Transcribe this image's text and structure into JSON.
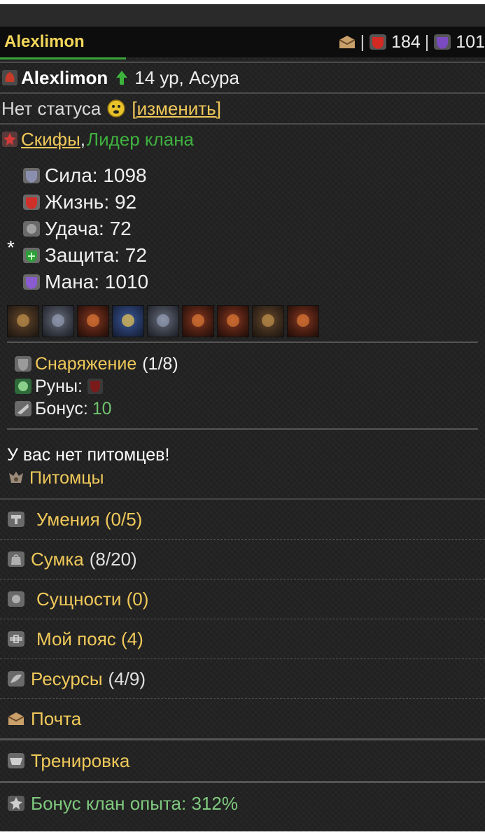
{
  "top": {
    "name": "Alexlimon",
    "health": "184",
    "mana": "101"
  },
  "profile": {
    "name": "Alexlimon",
    "level_race": "14 ур, Асура"
  },
  "status": {
    "text": "Нет статуса",
    "change": "[изменить]"
  },
  "clan": {
    "name": "Скифы",
    "comma": ",",
    "role": "Лидер клана"
  },
  "stats": [
    {
      "label": "Сила: 1098",
      "icon": "strength-icon",
      "color": "#8a8fb0"
    },
    {
      "label": "Жизнь: 92",
      "icon": "life-icon",
      "color": "#d0302a"
    },
    {
      "label": "Удача: 72",
      "icon": "luck-icon",
      "color": "#a0a0a0"
    },
    {
      "label": "Защита: 72",
      "icon": "defense-icon",
      "color": "#2e9e3a"
    },
    {
      "label": "Мана: 1010",
      "icon": "mana-icon",
      "color": "#8a5ad0"
    }
  ],
  "star": "*",
  "equip": {
    "gear_label": "Снаряжение",
    "gear_count": "(1/8)",
    "runes_label": "Руны:",
    "bonus_label": "Бонус:",
    "bonus_value": "10"
  },
  "pets": {
    "message": "У вас нет питомцев!",
    "link": "Питомцы"
  },
  "menu": {
    "skills": "Умения (0/5)",
    "bag_label": "Сумка",
    "bag_count": "(8/20)",
    "entities": "Сущности (0)",
    "belt": "Мой пояс (4)",
    "resources_label": "Ресурсы",
    "resources_count": "(4/9)",
    "mail": "Почта",
    "training": "Тренировка",
    "clan_bonus": "Бонус клан опыта: 312%"
  },
  "colors": {
    "accent_gold": "#f0c95a",
    "green": "#3fb13f",
    "name_yellow": "#f3d75a"
  }
}
